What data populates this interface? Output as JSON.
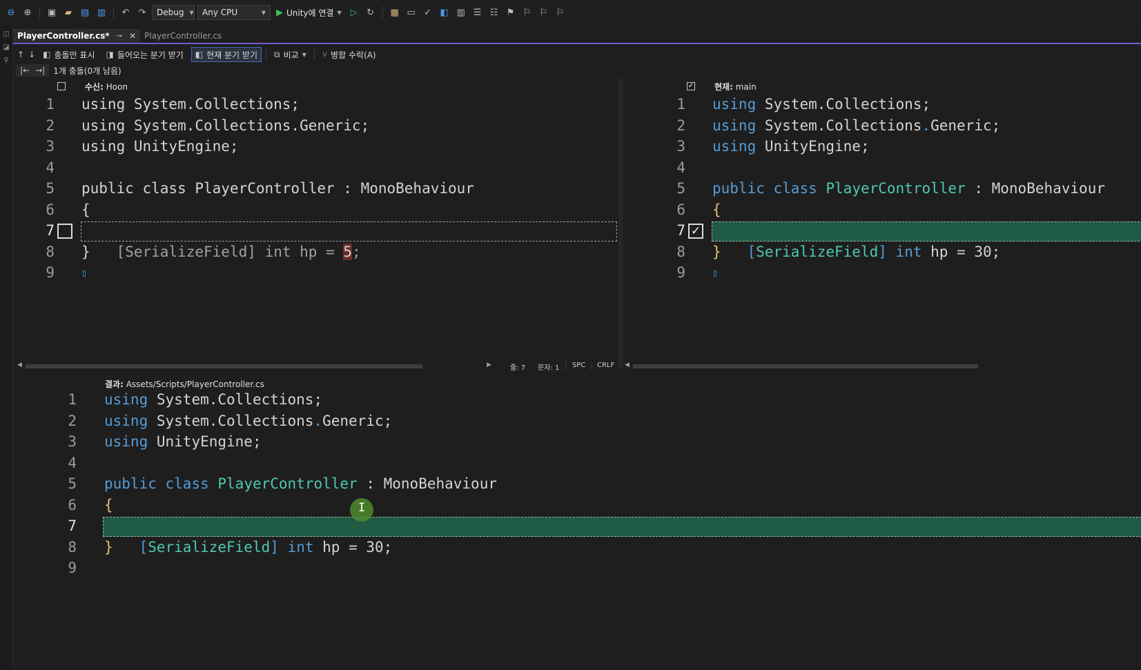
{
  "toolbar": {
    "config": "Debug",
    "platform": "Any CPU",
    "run_label": "Unity에 연결"
  },
  "tabs": [
    {
      "label": "PlayerController.cs*",
      "active": true
    },
    {
      "label": "PlayerController.cs",
      "active": false
    }
  ],
  "merge_toolbar": {
    "conflicts_only": "충돌만 표시",
    "take_incoming": "들어오는 분기 받기",
    "take_current": "현재 분기 받기",
    "compare": "비교",
    "accept_merge": "병합 수락(A)"
  },
  "conflict_status": "1개 충돌(0개 남음)",
  "left_pane": {
    "label": "수신:",
    "branch": "Hoon",
    "checked": false,
    "lines": [
      "using System.Collections;",
      "using System.Collections.Generic;",
      "using UnityEngine;",
      "",
      "public class PlayerController : MonoBehaviour",
      "{",
      "    [SerializeField] int hp = 5;",
      "}",
      ""
    ]
  },
  "right_pane": {
    "label": "현재:",
    "branch": "main",
    "checked": true
  },
  "result_pane": {
    "label": "결과:",
    "path": "Assets/Scripts/PlayerController.cs"
  },
  "code": {
    "using": "using",
    "ns1": "System.Collections;",
    "ns2a": "System.Collections",
    "ns2dot": ".",
    "ns2b": "Generic;",
    "ns3": "UnityEngine;",
    "public": "public",
    "class": "class",
    "classname": "PlayerController",
    "colon": " : ",
    "base": "MonoBehaviour",
    "open": "{",
    "close": "}",
    "attr_open": "[",
    "attr": "SerializeField",
    "attr_close": "]",
    "int": "int",
    "hp": " hp = ",
    "val_left": "5",
    "val_right": "30",
    "semi": ";"
  },
  "line_numbers": [
    "1",
    "2",
    "3",
    "4",
    "5",
    "6",
    "7",
    "8",
    "9"
  ],
  "status": {
    "line": "줄: 7",
    "char": "문자: 1",
    "spc": "SPC",
    "crlf": "CRLF"
  },
  "icons": {
    "back": "←",
    "play": "▶",
    "dropdown": "▾",
    "checkmark": "✓",
    "up": "↑",
    "down": "↓",
    "first": "|←",
    "last": "→|",
    "close": "✕",
    "pin": "⊸"
  },
  "colors": {
    "keyword": "#569cd6",
    "type": "#4ec9b0",
    "brace": "#e5c07b",
    "accepted_bg": "#1f5a44",
    "removed_bg": "#6b2b2b",
    "tab_accent": "#6f5bd1"
  }
}
